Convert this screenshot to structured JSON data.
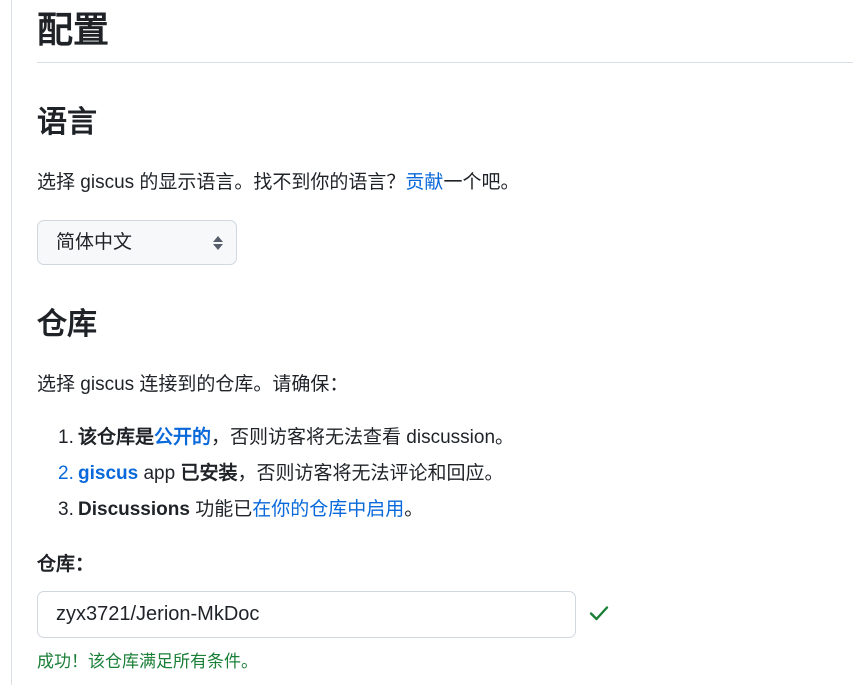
{
  "page": {
    "title": "配置"
  },
  "language": {
    "heading": "语言",
    "desc_before": "选择 giscus 的显示语言。找不到你的语言？",
    "contribute_link": "贡献",
    "desc_after": "一个吧。",
    "select_value": "简体中文"
  },
  "repository": {
    "heading": "仓库",
    "desc": "选择 giscus 连接到的仓库。请确保：",
    "items": [
      {
        "num": "1.",
        "bold_a": "该仓库是",
        "link": "公开的",
        "rest": "，否则访客将无法查看 discussion。"
      },
      {
        "num": "2.",
        "link": "giscus",
        "plain": " app ",
        "bold": "已安装",
        "rest": "，否则访客将无法评论和回应。"
      },
      {
        "num": "3.",
        "bold": "Discussions",
        "plain": " 功能已",
        "link": "在你的仓库中启用",
        "rest": "。"
      }
    ],
    "field_label": "仓库：",
    "input_value": "zyx3721/Jerion-MkDoc",
    "success_message": "成功！该仓库满足所有条件。",
    "success_color": "#1a7f37"
  }
}
